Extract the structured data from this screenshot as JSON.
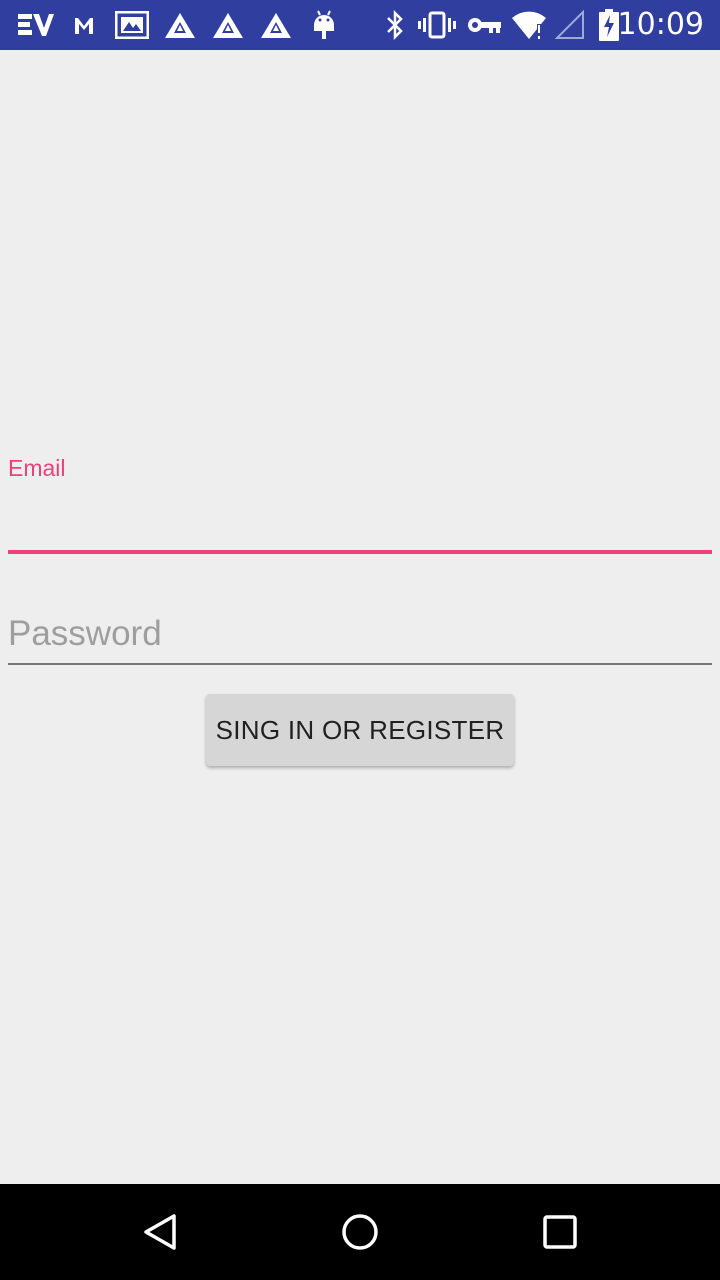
{
  "status_bar": {
    "background": "#303f9f",
    "time": "10:09",
    "left_icons": [
      "ev-icon",
      "gmail-icon",
      "photo-icon",
      "triangle-app-icon",
      "triangle-app-icon",
      "triangle-app-icon",
      "android-icon"
    ],
    "right_icons": [
      "bluetooth-icon",
      "vibrate-icon",
      "vpn-key-icon",
      "wifi-icon",
      "signal-icon",
      "battery-charging-icon"
    ]
  },
  "form": {
    "email_label": "Email",
    "email_value": "",
    "password_placeholder": "Password",
    "password_value": "",
    "submit_label": "SING IN OR REGISTER"
  },
  "colors": {
    "accent": "#ec407a",
    "background": "#eeeeee",
    "button": "#d6d6d6"
  },
  "nav_bar": {
    "icons": [
      "back-icon",
      "home-icon",
      "recents-icon"
    ]
  }
}
